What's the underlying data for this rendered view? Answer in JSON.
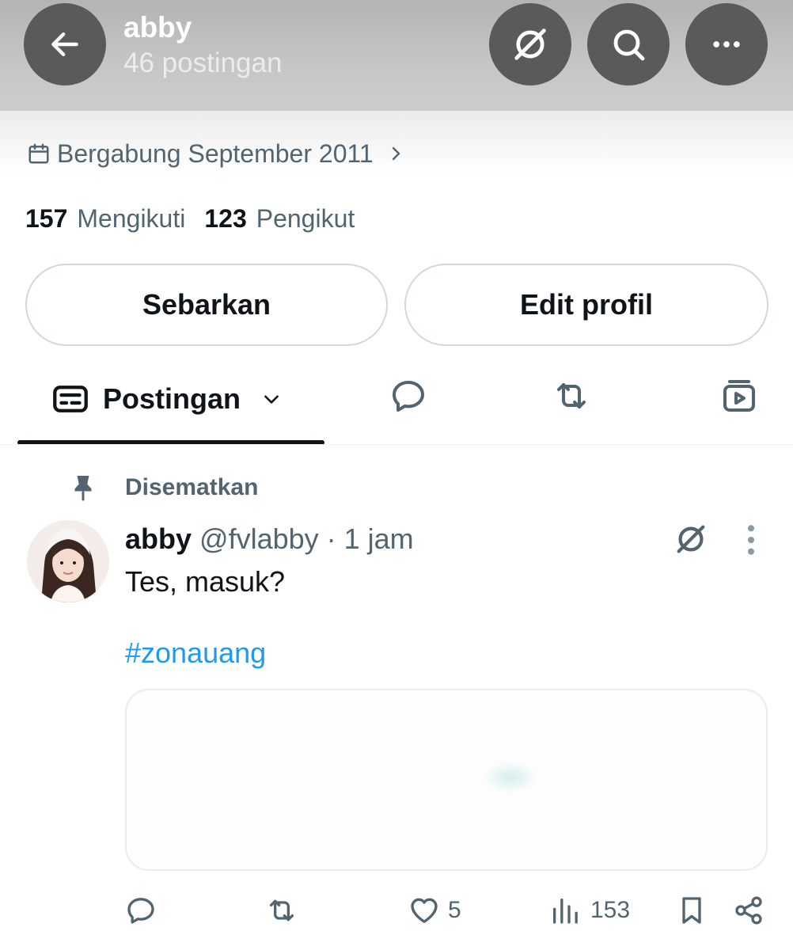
{
  "header": {
    "name": "abby",
    "post_count": "46 postingan",
    "back_icon": "arrow-left-icon",
    "grok_icon": "grok-icon",
    "search_icon": "search-icon",
    "more_icon": "more-horizontal-icon"
  },
  "profile": {
    "joined": "Bergabung September 2011",
    "following_count": "157",
    "following_label": "Mengikuti",
    "followers_count": "123",
    "followers_label": "Pengikut"
  },
  "buttons": {
    "share": "Sebarkan",
    "edit_profile": "Edit profil"
  },
  "tabs": {
    "active_label": "Postingan",
    "icons": [
      "posts-icon",
      "replies-icon",
      "reposts-icon",
      "media-icon"
    ]
  },
  "post": {
    "pinned_label": "Disematkan",
    "author_name": "abby",
    "meta": "@fvlabby · 1 jam",
    "text": "Tes, masuk?",
    "hashtag": "#zonauang",
    "likes": "5",
    "views": "153"
  },
  "colors": {
    "accent": "#1d9bf0",
    "text_primary": "#0f1419",
    "text_secondary": "#536471",
    "header_button": "#5a5a5a"
  }
}
